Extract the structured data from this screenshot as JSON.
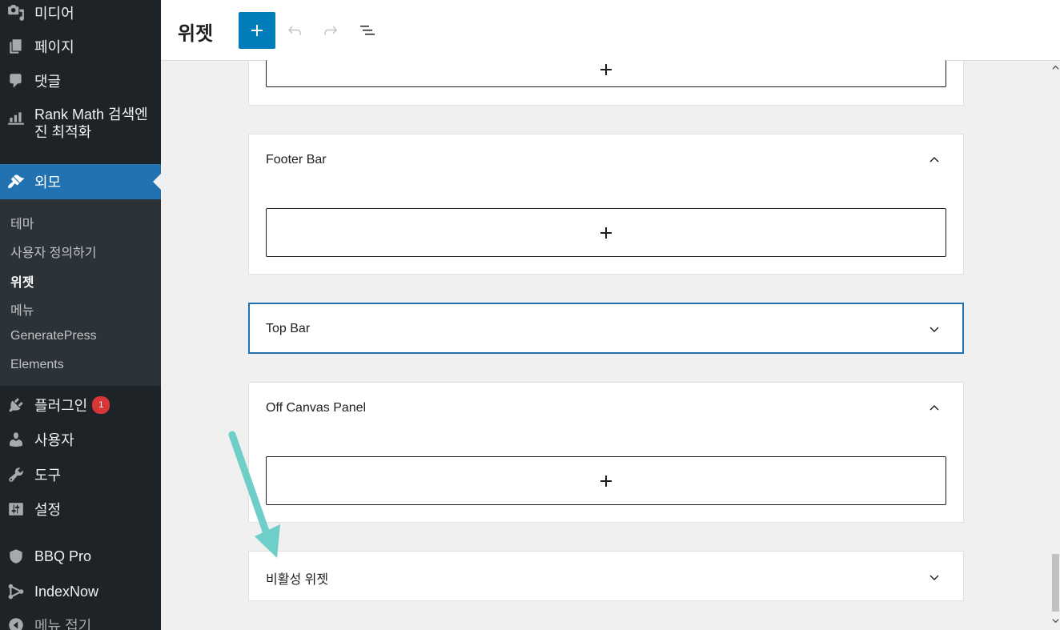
{
  "sidebar": {
    "items": [
      {
        "label": "미디어",
        "icon": "media-icon"
      },
      {
        "label": "페이지",
        "icon": "page-icon"
      },
      {
        "label": "댓글",
        "icon": "comment-icon"
      },
      {
        "label_line1": "Rank Math 검색엔",
        "label_line2": "진 최적화",
        "icon": "rank-math-icon"
      },
      {
        "label": "외모",
        "icon": "appearance-brush-icon"
      },
      {
        "label": "플러그인",
        "icon": "plugin-icon",
        "badge": "1"
      },
      {
        "label": "사용자",
        "icon": "user-icon"
      },
      {
        "label": "도구",
        "icon": "wrench-icon"
      },
      {
        "label": "설정",
        "icon": "settings-icon"
      },
      {
        "label": "BBQ Pro",
        "icon": "shield-icon"
      },
      {
        "label": "IndexNow",
        "icon": "indexnow-icon"
      },
      {
        "label": "메뉴 접기",
        "icon": "collapse-icon"
      }
    ],
    "submenu": [
      "테마",
      "사용자 정의하기",
      "위젯",
      "메뉴",
      "GeneratePress",
      "Elements"
    ],
    "current_submenu": "위젯"
  },
  "header": {
    "title": "위젯",
    "add_icon": "plus-icon",
    "undo_icon": "undo-icon",
    "redo_icon": "redo-icon",
    "list_view_icon": "list-view-icon"
  },
  "widget_areas": [
    {
      "title": "",
      "state": "expanded"
    },
    {
      "title": "Footer Bar",
      "state": "expanded"
    },
    {
      "title": "Top Bar",
      "state": "collapsed"
    },
    {
      "title": "Off Canvas Panel",
      "state": "expanded"
    },
    {
      "title": "비활성 위젯",
      "state": "collapsed"
    }
  ],
  "colors": {
    "sidebar_bg": "#1d2327",
    "active_menu": "#2271b1",
    "add_button": "#007cba",
    "badge": "#d63638",
    "arrow_annotation": "#6ecfc8"
  }
}
